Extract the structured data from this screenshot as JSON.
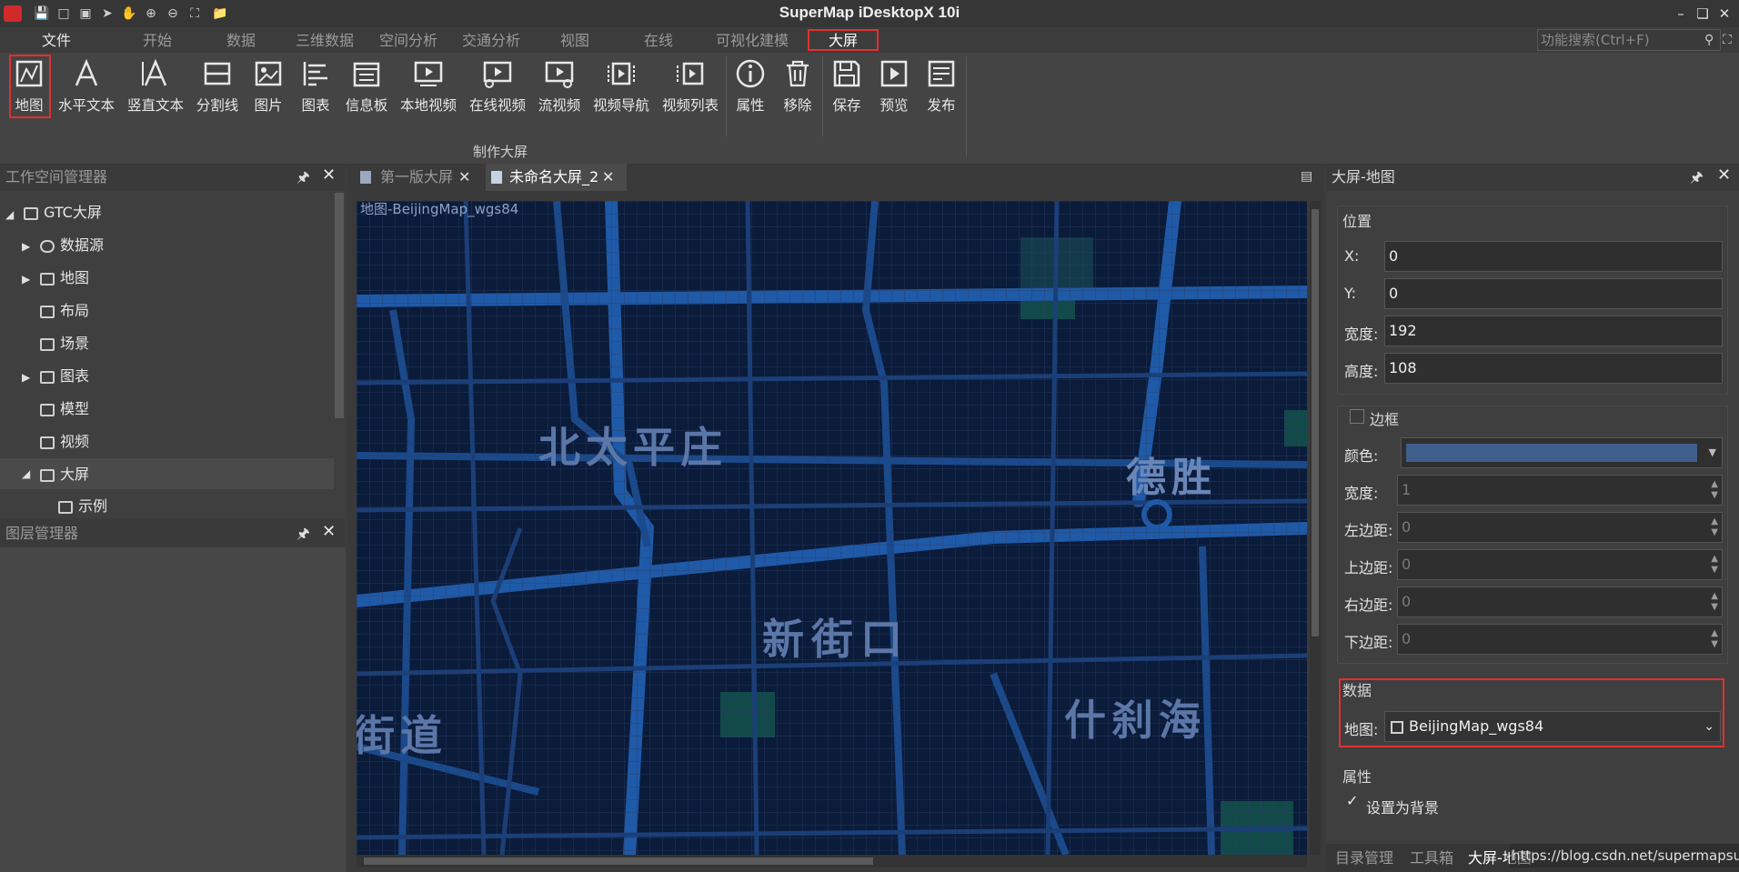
{
  "app": {
    "title": "SuperMap iDesktopX 10i",
    "search_placeholder": "功能搜索(Ctrl+F)",
    "quick_access": [
      "save-icon",
      "new-icon",
      "new-icon",
      "cursor-icon",
      "pan-icon",
      "zoom-in-icon",
      "zoom-out-icon",
      "full-extent-icon",
      "folder-icon"
    ]
  },
  "menu": {
    "file": "文件",
    "tabs": [
      "开始",
      "数据",
      "三维数据",
      "空间分析",
      "交通分析",
      "视图",
      "在线",
      "可视化建模",
      "大屏"
    ],
    "active": "大屏"
  },
  "ribbon": {
    "buttons": [
      "地图",
      "水平文本",
      "竖直文本",
      "分割线",
      "图片",
      "图表",
      "信息板",
      "本地视频",
      "在线视频",
      "流视频",
      "视频导航",
      "视频列表",
      "属性",
      "移除",
      "保存",
      "预览",
      "发布"
    ],
    "group_label": "制作大屏",
    "highlighted": "地图"
  },
  "workspace_panel": {
    "title": "工作空间管理器",
    "root": "GTC大屏",
    "items": [
      "数据源",
      "地图",
      "布局",
      "场景",
      "图表",
      "模型",
      "视频",
      "大屏"
    ],
    "child": "示例"
  },
  "layer_panel": {
    "title": "图层管理器"
  },
  "doc_tabs": [
    "第一版大屏",
    "未命名大屏_2"
  ],
  "map": {
    "label": "地图-BeijingMap_wgs84",
    "place_labels": [
      "北太平庄",
      "德胜",
      "新街口",
      "什刹海",
      "街道"
    ],
    "colors": {
      "background": "#0b1b3a",
      "road": "#1a4a8c",
      "green": "#124a4a",
      "text": "#5b77a8"
    }
  },
  "props_panel": {
    "title": "大屏-地图",
    "position_label": "位置",
    "x_label": "X:",
    "x": "0",
    "y_label": "Y:",
    "y": "0",
    "width_label": "宽度:",
    "width": "192",
    "height_label": "高度:",
    "height": "108",
    "border_label": "边框",
    "color_label": "颜色:",
    "border_color": "#3e5f8a",
    "border_width_label": "宽度:",
    "border_width": "1",
    "left_margin_label": "左边距:",
    "left_margin": "0",
    "top_margin_label": "上边距:",
    "top_margin": "0",
    "right_margin_label": "右边距:",
    "right_margin": "0",
    "bottom_margin_label": "下边距:",
    "bottom_margin": "0",
    "data_label": "数据",
    "map_label": "地图:",
    "map_value": "BeijingMap_wgs84",
    "attr_label": "属性",
    "bg_checkbox_label": "设置为背景",
    "bg_checked": "✓"
  },
  "bottom_tabs": [
    "目录管理",
    "工具箱",
    "大屏-地图"
  ],
  "watermark": "https://blog.csdn.net/supermapsupport"
}
